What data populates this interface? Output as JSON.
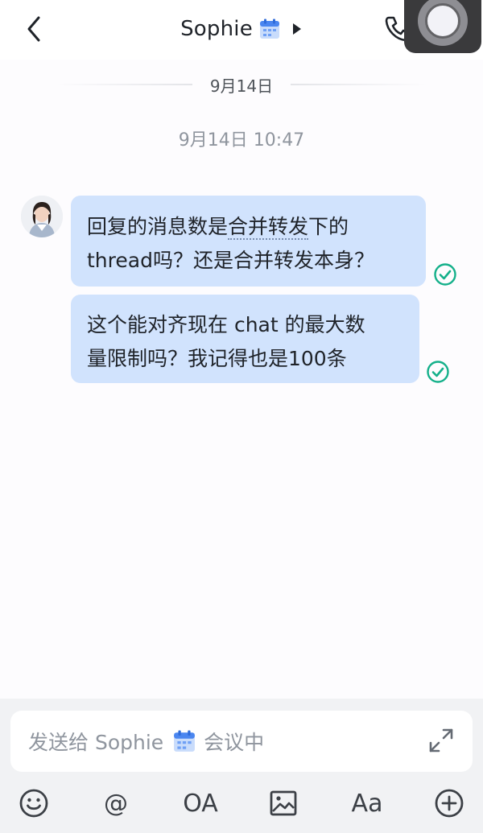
{
  "header": {
    "title": "Sophie",
    "icons": [
      "back-arrow-icon",
      "calendar-icon",
      "caret-right-icon",
      "phone-icon",
      "assistive-touch-icon"
    ]
  },
  "chat": {
    "date_separator": "9月14日",
    "timestamp": "9月14日 10:47",
    "messages": [
      {
        "sender": "self",
        "lines": [
          "回复的消息数是合并转发下的",
          "thread吗？还是合并转发本身？"
        ],
        "dotted_segment": "合并转发",
        "read": true
      },
      {
        "sender": "self",
        "lines": [
          "这个能对齐现在 chat 的最大数",
          "量限制吗？我记得也是100条"
        ],
        "read": true
      }
    ]
  },
  "composer": {
    "placeholder_prefix": "发送给 Sophie",
    "placeholder_suffix": "会议中",
    "toolbar": {
      "emoji": "emoji-icon",
      "mention": "@",
      "oa": "OA",
      "image": "image-icon",
      "format": "Aa",
      "more": "plus-icon"
    }
  },
  "colors": {
    "bubble": "#d1e3fd",
    "read_check": "#14b08a",
    "composer_bg": "#f1f2f4"
  }
}
